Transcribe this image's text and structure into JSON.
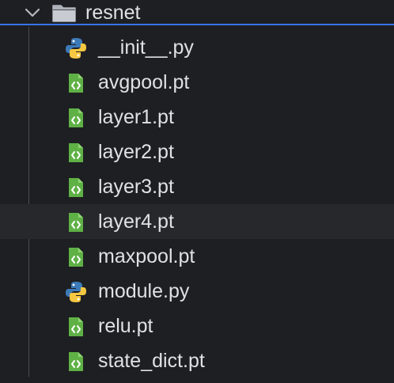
{
  "tree": {
    "folder": {
      "label": "resnet",
      "expanded": true,
      "icon": "folder-icon",
      "chevron": "chevron-down-icon"
    },
    "files": [
      {
        "label": "__init__.py",
        "icon": "python-file-icon"
      },
      {
        "label": "avgpool.pt",
        "icon": "pt-file-icon"
      },
      {
        "label": "layer1.pt",
        "icon": "pt-file-icon"
      },
      {
        "label": "layer2.pt",
        "icon": "pt-file-icon"
      },
      {
        "label": "layer3.pt",
        "icon": "pt-file-icon"
      },
      {
        "label": "layer4.pt",
        "icon": "pt-file-icon",
        "hovered": true
      },
      {
        "label": "maxpool.pt",
        "icon": "pt-file-icon"
      },
      {
        "label": "module.py",
        "icon": "python-file-icon"
      },
      {
        "label": "relu.pt",
        "icon": "pt-file-icon"
      },
      {
        "label": "state_dict.pt",
        "icon": "pt-file-icon"
      }
    ]
  },
  "colors": {
    "background": "#1e1f22",
    "hover_row": "#26282b",
    "selection_border": "#3574f0",
    "text": "#dfe1e5",
    "pt_icon": "#5fb146",
    "python_blue": "#3d7ab8",
    "python_yellow": "#f5c842"
  }
}
